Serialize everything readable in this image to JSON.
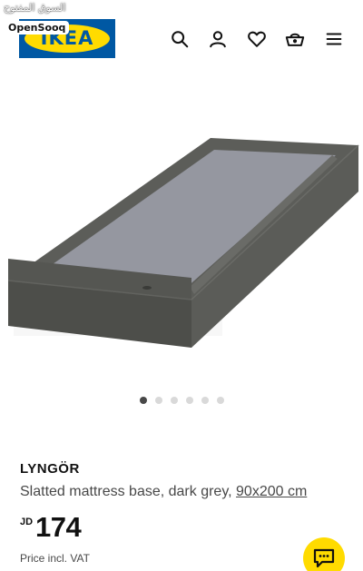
{
  "watermark": {
    "arabic_text": "السوق المفتوح",
    "latin_text": "OpenSooq"
  },
  "header": {
    "logo_text": "IKEA",
    "icons": [
      "search-icon",
      "user-icon",
      "heart-icon",
      "basket-icon",
      "menu-icon"
    ]
  },
  "carousel": {
    "total_images": 6,
    "active_index": 0
  },
  "product": {
    "name": "LYNGÖR",
    "description": "Slatted mattress base, dark grey, ",
    "size_link": "90x200 cm",
    "currency": "JD",
    "price": "174",
    "price_note": "Price incl. VAT"
  },
  "colors": {
    "brand_blue": "#0058a3",
    "brand_yellow": "#ffdb00",
    "text_primary": "#111111",
    "text_secondary": "#484848"
  }
}
